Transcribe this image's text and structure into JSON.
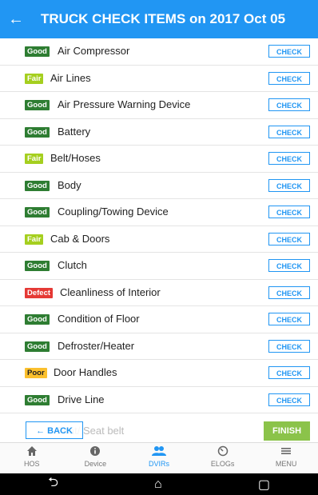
{
  "header": {
    "back_icon": "back-arrow-icon",
    "title": "TRUCK CHECK ITEMS on 2017 Oct 05"
  },
  "items": [
    {
      "status": "Good",
      "label": "Air Compressor"
    },
    {
      "status": "Fair",
      "label": "Air Lines"
    },
    {
      "status": "Good",
      "label": "Air Pressure Warning Device"
    },
    {
      "status": "Good",
      "label": "Battery"
    },
    {
      "status": "Fair",
      "label": "Belt/Hoses"
    },
    {
      "status": "Good",
      "label": "Body"
    },
    {
      "status": "Good",
      "label": "Coupling/Towing Device"
    },
    {
      "status": "Fair",
      "label": "Cab & Doors"
    },
    {
      "status": "Good",
      "label": "Clutch"
    },
    {
      "status": "Defect",
      "label": "Cleanliness of Interior"
    },
    {
      "status": "Good",
      "label": "Condition of Floor"
    },
    {
      "status": "Good",
      "label": "Defroster/Heater"
    },
    {
      "status": "Poor",
      "label": "Door Handles"
    },
    {
      "status": "Good",
      "label": "Drive Line"
    }
  ],
  "check_label": "CHECK",
  "partial_item": {
    "label": "Seat/ Seat belt"
  },
  "footer": {
    "back_label": "← BACK",
    "finish_label": "FINISH"
  },
  "nav": [
    {
      "label": "HOS",
      "icon": "home-icon"
    },
    {
      "label": "Device",
      "icon": "info-icon"
    },
    {
      "label": "DVIRs",
      "icon": "people-icon"
    },
    {
      "label": "ELOGs",
      "icon": "timer-icon"
    },
    {
      "label": "MENU",
      "icon": "menu-icon"
    }
  ],
  "colors": {
    "primary": "#2196f3",
    "good": "#2e7d32",
    "fair": "#a5cf1f",
    "defect": "#e53935",
    "poor": "#fbc02d",
    "finish": "#8bc34a"
  }
}
